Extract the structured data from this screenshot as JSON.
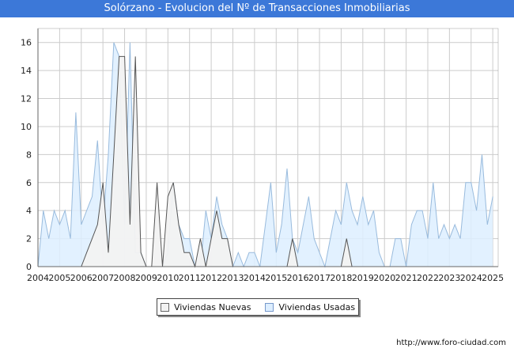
{
  "header": {
    "title": "Solórzano - Evolucion del Nº de Transacciones Inmobiliarias"
  },
  "footer": {
    "source": "http://www.foro-ciudad.com"
  },
  "colors": {
    "title_bg": "#3c78d8",
    "nuevas_fill": "#f2f2f2",
    "nuevas_line": "#555555",
    "usadas_fill": "#ddeeff",
    "usadas_line": "#99bbdd",
    "grid": "#cccccc"
  },
  "chart_data": {
    "type": "area",
    "title": "Solórzano - Evolucion del Nº de Transacciones Inmobiliarias",
    "xlabel": "",
    "ylabel": "",
    "xlim": [
      2004,
      2025.25
    ],
    "ylim": [
      0,
      17
    ],
    "yticks": [
      0,
      2,
      4,
      6,
      8,
      10,
      12,
      14,
      16
    ],
    "xticks": [
      "2004",
      "2005",
      "2006",
      "2007",
      "2008",
      "2009",
      "2010",
      "2011",
      "2012",
      "2013",
      "2014",
      "2015",
      "2016",
      "2017",
      "2018",
      "2019",
      "2020",
      "2021",
      "2022",
      "2023",
      "2024",
      "2025"
    ],
    "grid": true,
    "legend_position": "bottom",
    "x_step": 0.25,
    "series": [
      {
        "name": "Viviendas Nuevas",
        "values": [
          0,
          0,
          0,
          0,
          0,
          0,
          0,
          0,
          0,
          1,
          2,
          3,
          6,
          1,
          8,
          15,
          15,
          3,
          15,
          1,
          0,
          0,
          6,
          0,
          5,
          6,
          3,
          1,
          1,
          0,
          2,
          0,
          2,
          4,
          2,
          2,
          0,
          0,
          0,
          0,
          0,
          0,
          0,
          0,
          0,
          0,
          0,
          2,
          0,
          0,
          0,
          0,
          0,
          0,
          0,
          0,
          0,
          2,
          0,
          0,
          0,
          0,
          0,
          0,
          0,
          0,
          0,
          0,
          0,
          0,
          0,
          0,
          0,
          0,
          0,
          0,
          0,
          0,
          0,
          0,
          0,
          0,
          0,
          0,
          0,
          0
        ]
      },
      {
        "name": "Viviendas Usadas",
        "values": [
          0,
          4,
          2,
          4,
          3,
          4,
          2,
          11,
          3,
          4,
          5,
          9,
          3,
          8,
          16,
          15,
          3,
          16,
          1,
          1,
          0,
          0,
          0,
          0,
          1,
          6,
          3,
          2,
          2,
          0,
          0,
          4,
          2,
          5,
          3,
          2,
          0,
          1,
          0,
          1,
          1,
          0,
          3,
          6,
          1,
          3,
          7,
          2,
          1,
          3,
          5,
          2,
          1,
          0,
          2,
          4,
          3,
          6,
          4,
          3,
          5,
          3,
          4,
          1,
          0,
          0,
          2,
          2,
          0,
          3,
          4,
          4,
          2,
          6,
          2,
          3,
          2,
          3,
          2,
          6,
          6,
          4,
          8,
          3,
          5
        ]
      }
    ]
  }
}
